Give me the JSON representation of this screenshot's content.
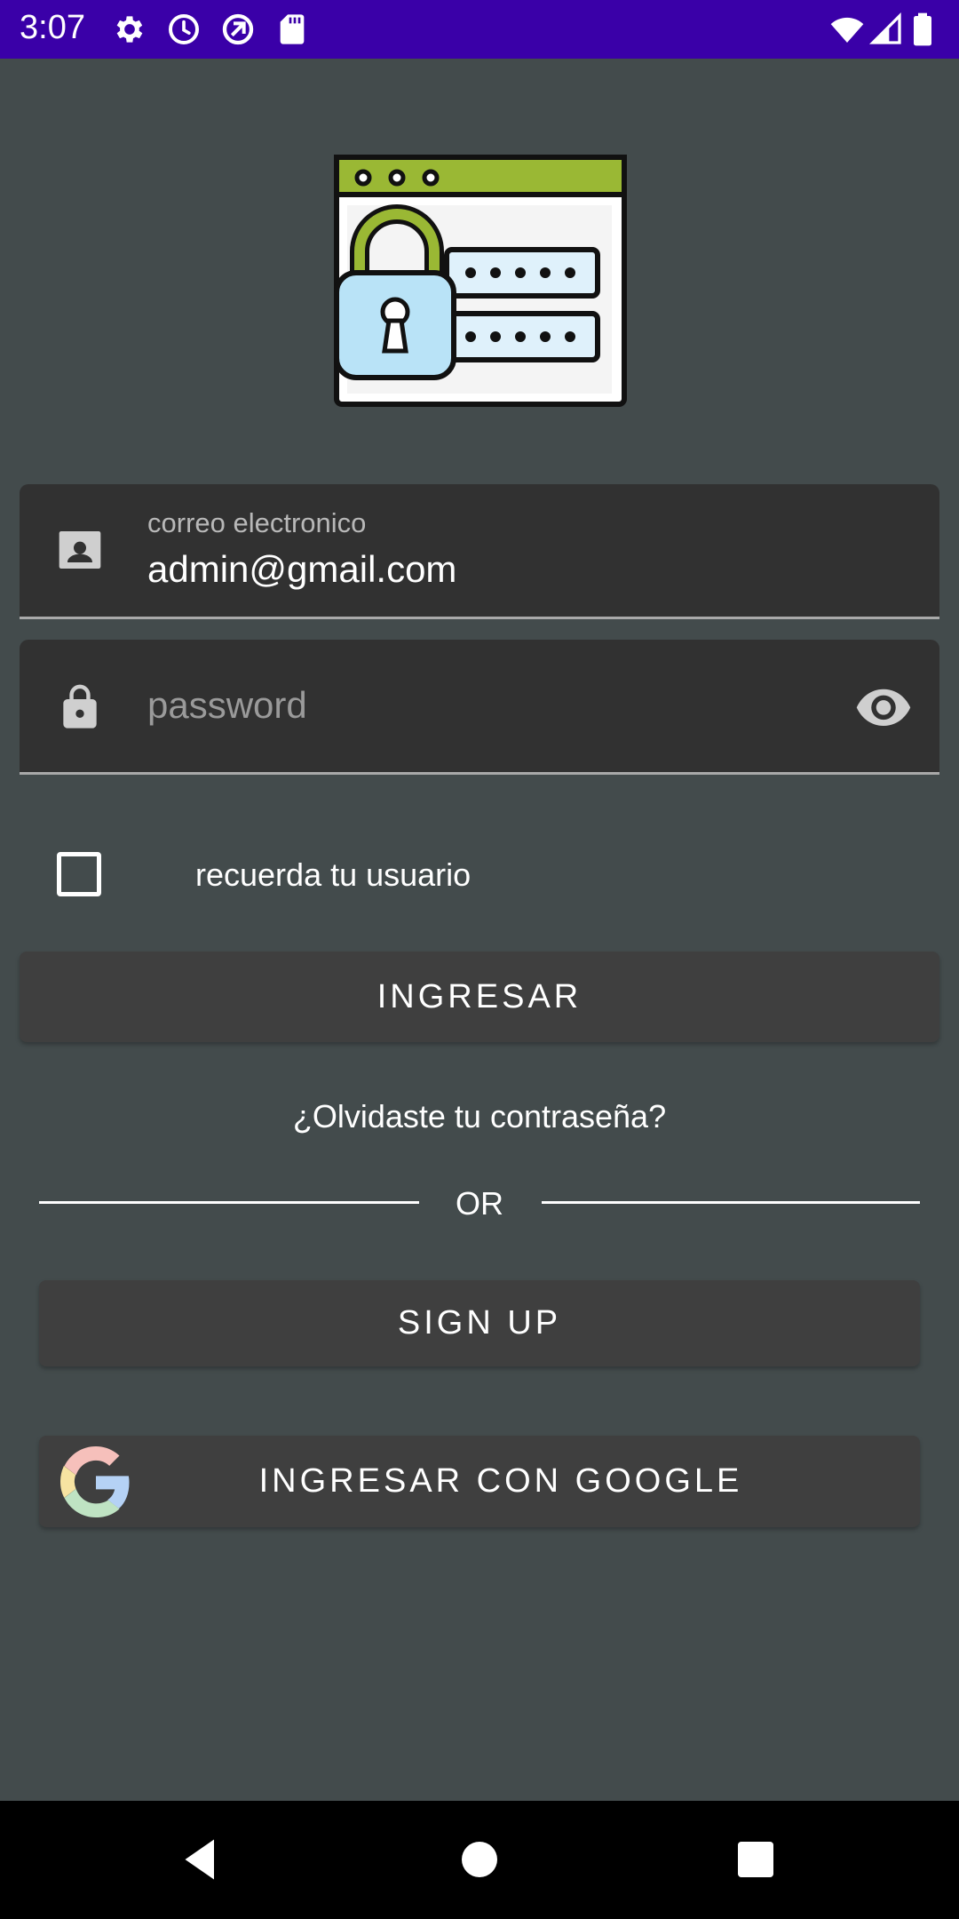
{
  "status_bar": {
    "time": "3:07",
    "left_icons": [
      "gear-icon",
      "alarm-clock-icon",
      "data-saver-icon",
      "sd-card-icon"
    ],
    "right_icons": [
      "wifi-icon",
      "cellular-signal-icon",
      "battery-icon"
    ],
    "background": "#3a00a8"
  },
  "hero": {
    "icon": "secure-login-illustration-icon"
  },
  "email_field": {
    "label": "correo electronico",
    "value": "admin@gmail.com",
    "icon": "contact-card-icon"
  },
  "password_field": {
    "placeholder": "password",
    "value": "",
    "icon": "lock-icon",
    "toggle_icon": "eye-icon"
  },
  "remember": {
    "label": "recuerda tu usuario",
    "checked": false
  },
  "buttons": {
    "login": "INGRESAR",
    "signup": "SIGN UP",
    "google": "INGRESAR CON GOOGLE"
  },
  "forgot_password": "¿Olvidaste tu contraseña?",
  "divider": {
    "text": "OR"
  },
  "nav_bar": {
    "buttons": [
      "back-icon",
      "home-icon",
      "recents-icon"
    ]
  },
  "colors": {
    "background": "#434b4c",
    "field_background": "#313131",
    "button_background": "#3f3f3f",
    "status_bar": "#3a00a8",
    "accent_green": "#9ab834",
    "lock_blue": "#b9e3f7"
  }
}
